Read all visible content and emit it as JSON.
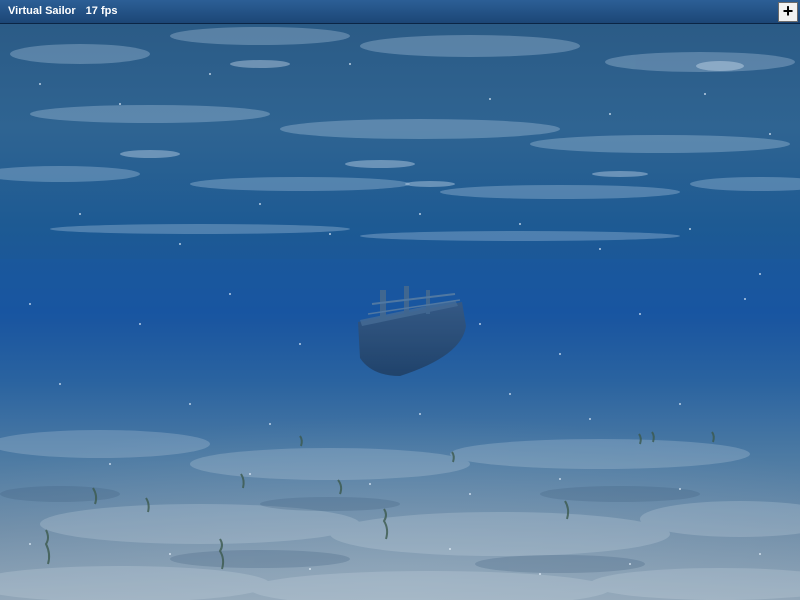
{
  "window": {
    "title": "Virtual Sailor",
    "fps": "17 fps",
    "expand_button_label": "+"
  },
  "scene": {
    "description_icons": [
      "ship-wreck-icon",
      "seaweed-icon",
      "particle-icon"
    ],
    "colors": {
      "surface": "#2d5f8e",
      "deep_water": "#0f4a8a",
      "sand": "#6f8ea8",
      "ship": "#2b4a6e"
    }
  }
}
